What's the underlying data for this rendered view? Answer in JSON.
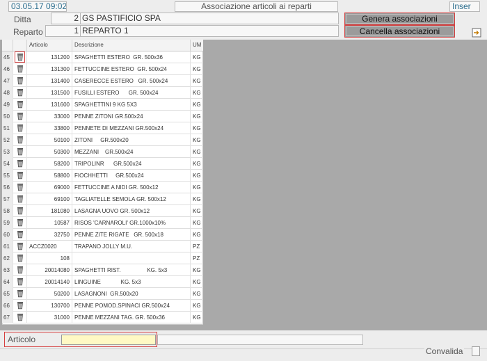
{
  "header": {
    "datetime": "03.05.17 09:02",
    "title": "Associazione articoli ai reparti",
    "mode": "Inser"
  },
  "form": {
    "ditta_label": "Ditta",
    "ditta_code": "2",
    "ditta_name": "GS PASTIFICIO SPA",
    "reparto_label": "Reparto",
    "reparto_code": "1",
    "reparto_name": "REPARTO 1"
  },
  "buttons": {
    "genera": "Genera associazioni",
    "cancella": "Cancella associazioni"
  },
  "grid": {
    "columns": {
      "articolo": "Articolo",
      "descrizione": "Descrizione",
      "um": "UM"
    },
    "rows": [
      {
        "n": "45",
        "art": "131200",
        "desc": "SPAGHETTI ESTERO  GR. 500x36",
        "um": "KG",
        "hl": true
      },
      {
        "n": "46",
        "art": "131300",
        "desc": "FETTUCCINE ESTERO  GR. 500x24",
        "um": "KG"
      },
      {
        "n": "47",
        "art": "131400",
        "desc": "CASERECCE ESTERO   GR. 500x24",
        "um": "KG"
      },
      {
        "n": "48",
        "art": "131500",
        "desc": "FUSILLI ESTERO      GR. 500x24",
        "um": "KG"
      },
      {
        "n": "49",
        "art": "131600",
        "desc": "SPAGHETTINI 9 KG 5X3",
        "um": "KG"
      },
      {
        "n": "50",
        "art": "33000",
        "desc": "PENNE ZITONI GR.500x24",
        "um": "KG"
      },
      {
        "n": "51",
        "art": "33800",
        "desc": "PENNETE DI MEZZANI GR.500x24",
        "um": "KG"
      },
      {
        "n": "52",
        "art": "50100",
        "desc": "ZITONI     GR.500x20",
        "um": "KG"
      },
      {
        "n": "53",
        "art": "50300",
        "desc": "MEZZANI    GR.500x24",
        "um": "KG"
      },
      {
        "n": "54",
        "art": "58200",
        "desc": "TRIPOLINR      GR.500x24",
        "um": "KG"
      },
      {
        "n": "55",
        "art": "58800",
        "desc": "FIOCHHETTI     GR.500x24",
        "um": "KG"
      },
      {
        "n": "56",
        "art": "69000",
        "desc": "FETTUCCINE A NIDI GR. 500x12",
        "um": "KG"
      },
      {
        "n": "57",
        "art": "69100",
        "desc": "TAGLIATELLE SEMOLA GR. 500x12",
        "um": "KG"
      },
      {
        "n": "58",
        "art": "181080",
        "desc": "LASAGNA UOVO GR. 500x12",
        "um": "KG"
      },
      {
        "n": "59",
        "art": "10587",
        "desc": "RISOS 'CARNAROLI' GR.1000x10%",
        "um": "KG"
      },
      {
        "n": "60",
        "art": "32750",
        "desc": "PENNE ZITE RIGATE   GR. 500x18",
        "um": "KG"
      },
      {
        "n": "61",
        "art": "ACCZ0020",
        "desc": "TRAPANO JOLLY M.U.",
        "um": "PZ",
        "left": true
      },
      {
        "n": "62",
        "art": "108",
        "desc": "",
        "um": "PZ"
      },
      {
        "n": "63",
        "art": "20014080",
        "desc": "SPAGHETTI RIST.                 KG. 5x3",
        "um": "KG"
      },
      {
        "n": "64",
        "art": "20014140",
        "desc": "LINGUINE             KG. 5x3",
        "um": "KG"
      },
      {
        "n": "65",
        "art": "50200",
        "desc": "LASAGNONI  GR.500x20",
        "um": "KG"
      },
      {
        "n": "66",
        "art": "130700",
        "desc": "PENNE POMOD.SPINACI GR.500x24",
        "um": "KG"
      },
      {
        "n": "67",
        "art": "31000",
        "desc": "PENNE MEZZANI TAG. GR. 500x36",
        "um": "KG"
      }
    ]
  },
  "footer": {
    "articolo_label": "Articolo",
    "articolo_value": "",
    "convalida_label": "Convalida"
  },
  "icons": {
    "row_delete": "trash-icon",
    "exit": "exit-icon"
  }
}
